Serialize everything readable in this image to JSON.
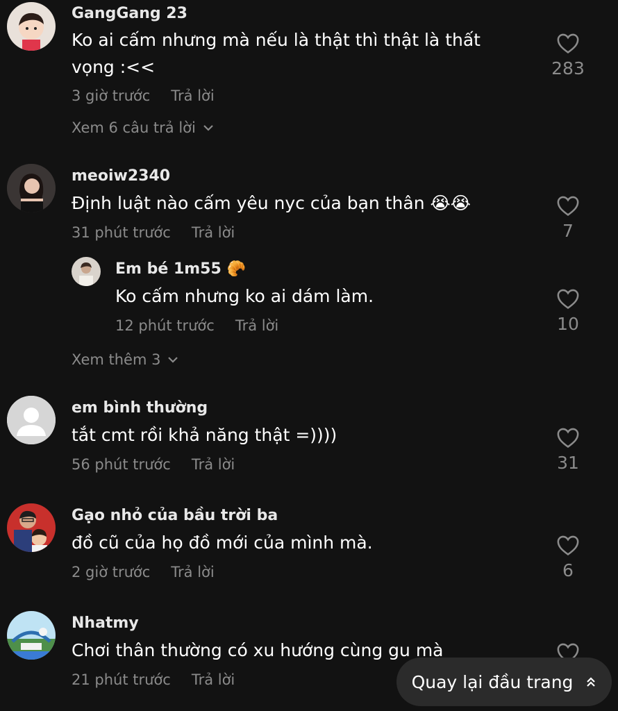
{
  "comments": [
    {
      "username": "GangGang 23",
      "text": "Ko ai cấm nhưng mà nếu là thật thì thật là thất vọng :<<",
      "time": "3 giờ trước",
      "reply": "Trả lời",
      "likes": "283",
      "more": "Xem 6 câu trả lời"
    },
    {
      "username": "meoiw2340",
      "text": "Định luật nào cấm yêu nyc của bạn thân 😭😭",
      "time": "31 phút trước",
      "reply": "Trả lời",
      "likes": "7",
      "more": "Xem thêm 3"
    },
    {
      "username": "em bình thường",
      "text": "tắt cmt rồi khả năng thật =))))",
      "time": "56 phút trước",
      "reply": "Trả lời",
      "likes": "31"
    },
    {
      "username": "Gạo nhỏ của bầu trời ba",
      "text": "đồ cũ của họ đồ mới của mình mà.",
      "time": "2 giờ trước",
      "reply": "Trả lời",
      "likes": "6"
    },
    {
      "username": "Nhatmy",
      "text": "Chơi thân thường có xu hướng cùng gu mà",
      "time": "21 phút trước",
      "reply": "Trả lời",
      "likes": ""
    }
  ],
  "nested_reply": {
    "username": "Em bé 1m55 🥐",
    "text": "Ko cấm nhưng ko ai dám làm.",
    "time": "12 phút trước",
    "reply": "Trả lời",
    "likes": "10"
  },
  "back_to_top": {
    "label": "Quay lại đầu trang"
  },
  "icons": {
    "like": "heart-outline-icon",
    "expand": "chevron-down-icon",
    "back": "double-chevron-up-icon"
  },
  "colors": {
    "background": "#121212",
    "muted": "#8b8b8b",
    "pill": "#2b2b2b"
  }
}
